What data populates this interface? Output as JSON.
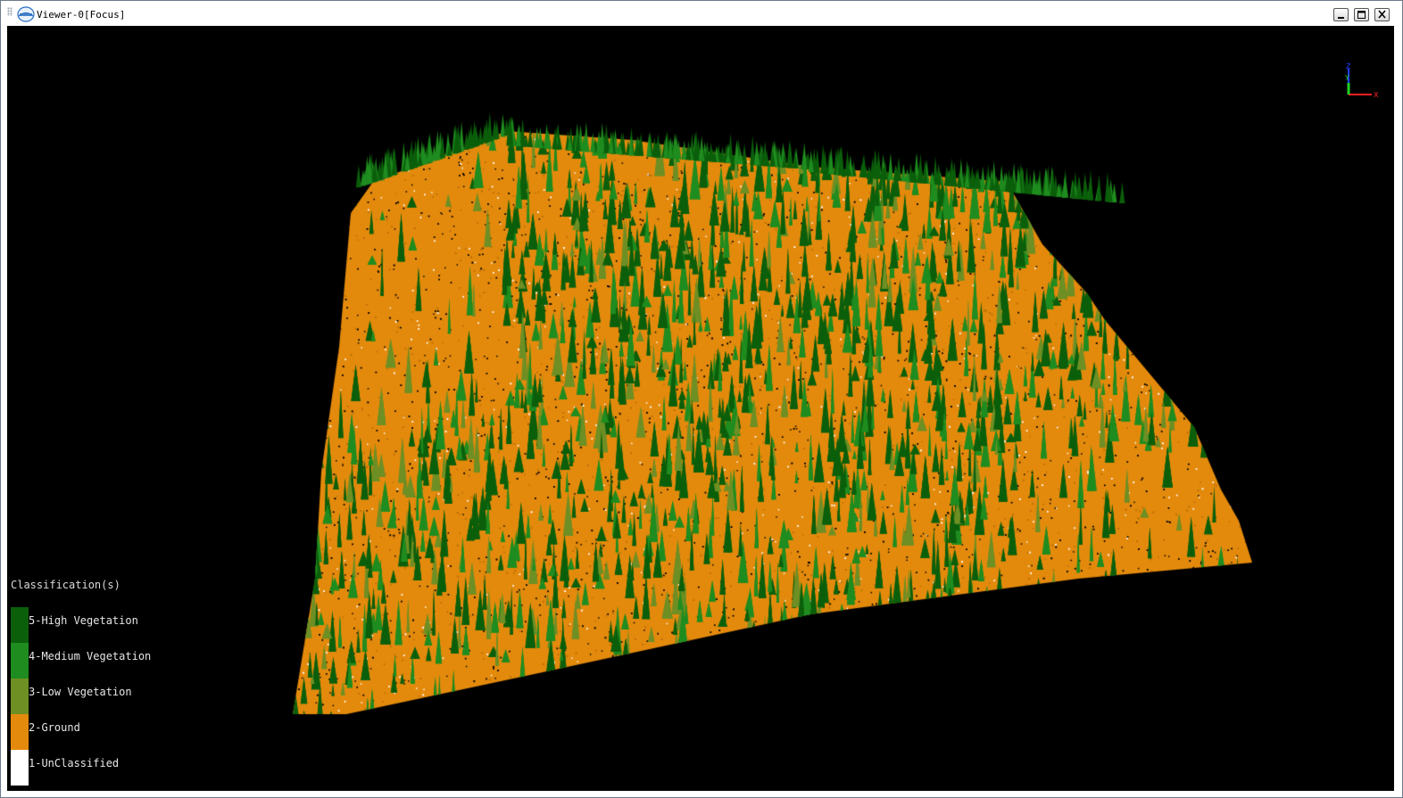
{
  "window": {
    "title": "Viewer-0[Focus]",
    "logo_icon": "lidar-app-logo-icon",
    "buttons": {
      "minimize_icon": "minimize-icon",
      "maximize_icon": "maximize-icon",
      "close_icon": "close-icon"
    }
  },
  "viewport": {
    "background": "#000000",
    "axis_gizmo": {
      "x_label": "X",
      "y_label": "Y",
      "z_label": "Z",
      "x_color": "#ff2020",
      "y_color": "#20d020",
      "z_color": "#2040ff"
    }
  },
  "legend": {
    "title": "Classification(s)",
    "items": [
      {
        "label": "5-High Vegetation",
        "color": "#0b5f0b"
      },
      {
        "label": "4-Medium Vegetation",
        "color": "#1f8c1f"
      },
      {
        "label": "3-Low Vegetation",
        "color": "#6e8f24"
      },
      {
        "label": "2-Ground",
        "color": "#e38a0c"
      },
      {
        "label": "1-UnClassified",
        "color": "#ffffff"
      }
    ]
  }
}
